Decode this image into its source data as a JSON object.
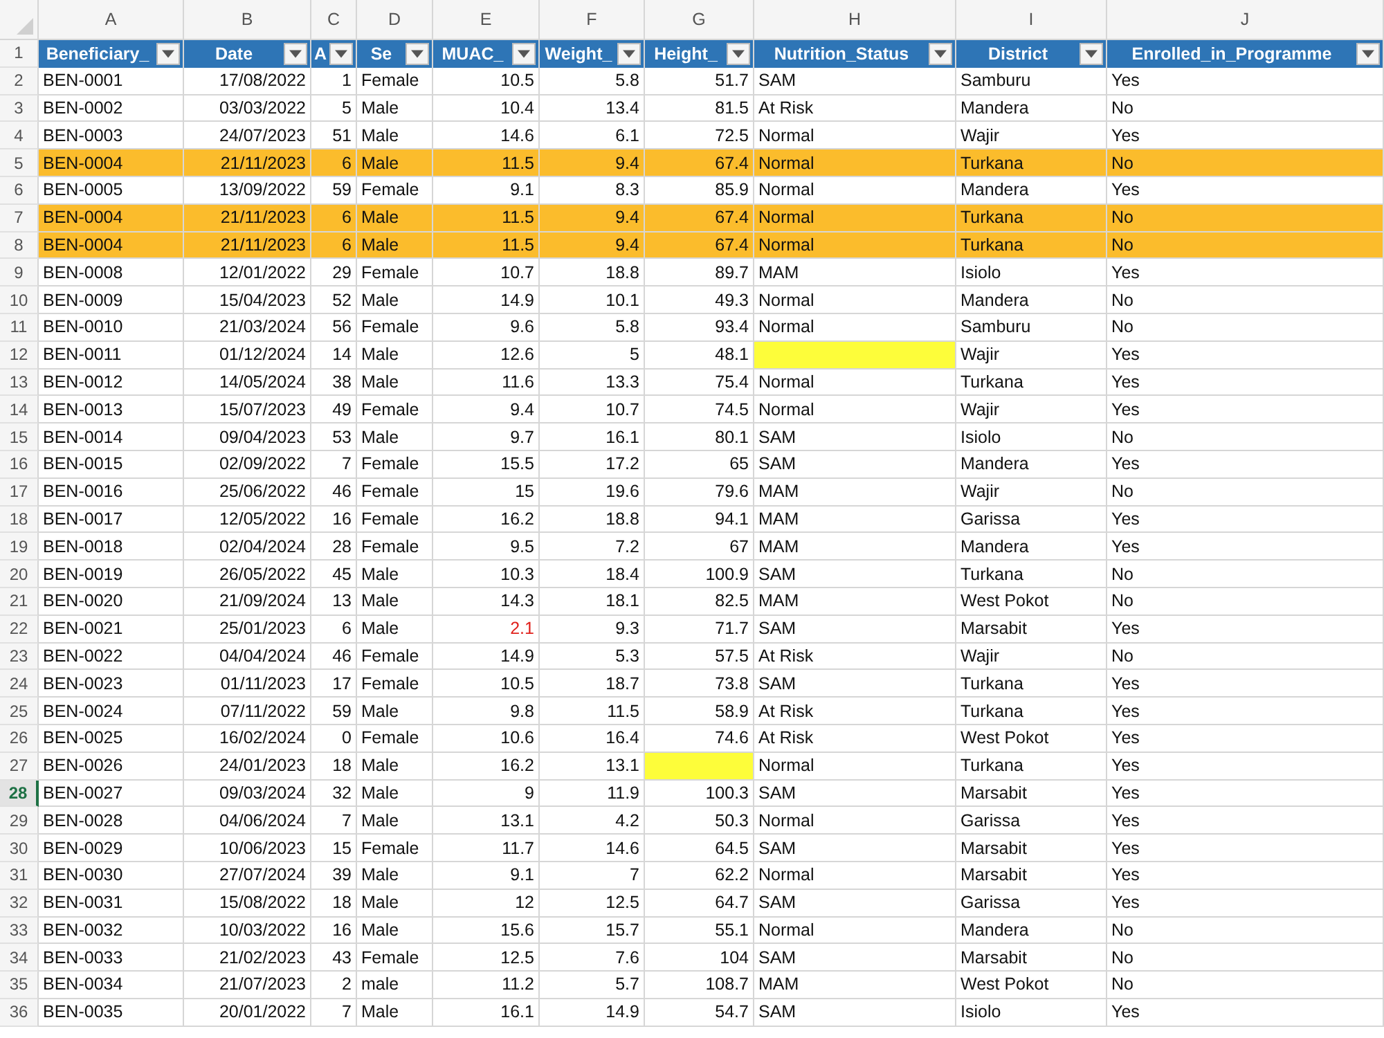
{
  "columns": [
    {
      "letter": "A",
      "header": "Beneficiary_",
      "kind": "text"
    },
    {
      "letter": "B",
      "header": "Date",
      "kind": "number"
    },
    {
      "letter": "C",
      "header": "A",
      "kind": "number"
    },
    {
      "letter": "D",
      "header": "Se",
      "kind": "text"
    },
    {
      "letter": "E",
      "header": "MUAC_",
      "kind": "number"
    },
    {
      "letter": "F",
      "header": "Weight_",
      "kind": "number"
    },
    {
      "letter": "G",
      "header": "Height_",
      "kind": "number"
    },
    {
      "letter": "H",
      "header": "Nutrition_Status",
      "kind": "text"
    },
    {
      "letter": "I",
      "header": "District",
      "kind": "text"
    },
    {
      "letter": "J",
      "header": "Enrolled_in_Programme",
      "kind": "text"
    }
  ],
  "header_row": "1",
  "rows": [
    {
      "num": "2",
      "cells": [
        "BEN-0001",
        "17/08/2022",
        "1",
        "Female",
        "10.5",
        "5.8",
        "51.7",
        "SAM",
        "Samburu",
        "Yes"
      ],
      "duplicate": false,
      "selected": false,
      "muac_flagged": false
    },
    {
      "num": "3",
      "cells": [
        "BEN-0002",
        "03/03/2022",
        "5",
        "Male",
        "10.4",
        "13.4",
        "81.5",
        "At Risk",
        "Mandera",
        "No"
      ],
      "duplicate": false,
      "selected": false,
      "muac_flagged": false
    },
    {
      "num": "4",
      "cells": [
        "BEN-0003",
        "24/07/2023",
        "51",
        "Male",
        "14.6",
        "6.1",
        "72.5",
        "Normal",
        "Wajir",
        "Yes"
      ],
      "duplicate": false,
      "selected": false,
      "muac_flagged": false
    },
    {
      "num": "5",
      "cells": [
        "BEN-0004",
        "21/11/2023",
        "6",
        "Male",
        "11.5",
        "9.4",
        "67.4",
        "Normal",
        "Turkana",
        "No"
      ],
      "duplicate": true,
      "selected": false,
      "muac_flagged": false
    },
    {
      "num": "6",
      "cells": [
        "BEN-0005",
        "13/09/2022",
        "59",
        "Female",
        "9.1",
        "8.3",
        "85.9",
        "Normal",
        "Mandera",
        "Yes"
      ],
      "duplicate": false,
      "selected": false,
      "muac_flagged": false
    },
    {
      "num": "7",
      "cells": [
        "BEN-0004",
        "21/11/2023",
        "6",
        "Male",
        "11.5",
        "9.4",
        "67.4",
        "Normal",
        "Turkana",
        "No"
      ],
      "duplicate": true,
      "selected": false,
      "muac_flagged": false
    },
    {
      "num": "8",
      "cells": [
        "BEN-0004",
        "21/11/2023",
        "6",
        "Male",
        "11.5",
        "9.4",
        "67.4",
        "Normal",
        "Turkana",
        "No"
      ],
      "duplicate": true,
      "selected": false,
      "muac_flagged": false
    },
    {
      "num": "9",
      "cells": [
        "BEN-0008",
        "12/01/2022",
        "29",
        "Female",
        "10.7",
        "18.8",
        "89.7",
        "MAM",
        "Isiolo",
        "Yes"
      ],
      "duplicate": false,
      "selected": false,
      "muac_flagged": false
    },
    {
      "num": "10",
      "cells": [
        "BEN-0009",
        "15/04/2023",
        "52",
        "Male",
        "14.9",
        "10.1",
        "49.3",
        "Normal",
        "Mandera",
        "No"
      ],
      "duplicate": false,
      "selected": false,
      "muac_flagged": false
    },
    {
      "num": "11",
      "cells": [
        "BEN-0010",
        "21/03/2024",
        "56",
        "Female",
        "9.6",
        "5.8",
        "93.4",
        "Normal",
        "Samburu",
        "No"
      ],
      "duplicate": false,
      "selected": false,
      "muac_flagged": false
    },
    {
      "num": "12",
      "cells": [
        "BEN-0011",
        "01/12/2024",
        "14",
        "Male",
        "12.6",
        "5",
        "48.1",
        null,
        "Wajir",
        "Yes"
      ],
      "duplicate": false,
      "selected": false,
      "muac_flagged": false
    },
    {
      "num": "13",
      "cells": [
        "BEN-0012",
        "14/05/2024",
        "38",
        "Male",
        "11.6",
        "13.3",
        "75.4",
        "Normal",
        "Turkana",
        "Yes"
      ],
      "duplicate": false,
      "selected": false,
      "muac_flagged": false
    },
    {
      "num": "14",
      "cells": [
        "BEN-0013",
        "15/07/2023",
        "49",
        "Female",
        "9.4",
        "10.7",
        "74.5",
        "Normal",
        "Wajir",
        "Yes"
      ],
      "duplicate": false,
      "selected": false,
      "muac_flagged": false
    },
    {
      "num": "15",
      "cells": [
        "BEN-0014",
        "09/04/2023",
        "53",
        "Male",
        "9.7",
        "16.1",
        "80.1",
        "SAM",
        "Isiolo",
        "No"
      ],
      "duplicate": false,
      "selected": false,
      "muac_flagged": false
    },
    {
      "num": "16",
      "cells": [
        "BEN-0015",
        "02/09/2022",
        "7",
        "Female",
        "15.5",
        "17.2",
        "65",
        "SAM",
        "Mandera",
        "Yes"
      ],
      "duplicate": false,
      "selected": false,
      "muac_flagged": false
    },
    {
      "num": "17",
      "cells": [
        "BEN-0016",
        "25/06/2022",
        "46",
        "Female",
        "15",
        "19.6",
        "79.6",
        "MAM",
        "Wajir",
        "No"
      ],
      "duplicate": false,
      "selected": false,
      "muac_flagged": false
    },
    {
      "num": "18",
      "cells": [
        "BEN-0017",
        "12/05/2022",
        "16",
        "Female",
        "16.2",
        "18.8",
        "94.1",
        "MAM",
        "Garissa",
        "Yes"
      ],
      "duplicate": false,
      "selected": false,
      "muac_flagged": false
    },
    {
      "num": "19",
      "cells": [
        "BEN-0018",
        "02/04/2024",
        "28",
        "Female",
        "9.5",
        "7.2",
        "67",
        "MAM",
        "Mandera",
        "Yes"
      ],
      "duplicate": false,
      "selected": false,
      "muac_flagged": false
    },
    {
      "num": "20",
      "cells": [
        "BEN-0019",
        "26/05/2022",
        "45",
        "Male",
        "10.3",
        "18.4",
        "100.9",
        "SAM",
        "Turkana",
        "No"
      ],
      "duplicate": false,
      "selected": false,
      "muac_flagged": false
    },
    {
      "num": "21",
      "cells": [
        "BEN-0020",
        "21/09/2024",
        "13",
        "Male",
        "14.3",
        "18.1",
        "82.5",
        "MAM",
        "West Pokot",
        "No"
      ],
      "duplicate": false,
      "selected": false,
      "muac_flagged": false
    },
    {
      "num": "22",
      "cells": [
        "BEN-0021",
        "25/01/2023",
        "6",
        "Male",
        "2.1",
        "9.3",
        "71.7",
        "SAM",
        "Marsabit",
        "Yes"
      ],
      "duplicate": false,
      "selected": false,
      "muac_flagged": true
    },
    {
      "num": "23",
      "cells": [
        "BEN-0022",
        "04/04/2024",
        "46",
        "Female",
        "14.9",
        "5.3",
        "57.5",
        "At Risk",
        "Wajir",
        "No"
      ],
      "duplicate": false,
      "selected": false,
      "muac_flagged": false
    },
    {
      "num": "24",
      "cells": [
        "BEN-0023",
        "01/11/2023",
        "17",
        "Female",
        "10.5",
        "18.7",
        "73.8",
        "SAM",
        "Turkana",
        "Yes"
      ],
      "duplicate": false,
      "selected": false,
      "muac_flagged": false
    },
    {
      "num": "25",
      "cells": [
        "BEN-0024",
        "07/11/2022",
        "59",
        "Male",
        "9.8",
        "11.5",
        "58.9",
        "At Risk",
        "Turkana",
        "Yes"
      ],
      "duplicate": false,
      "selected": false,
      "muac_flagged": false
    },
    {
      "num": "26",
      "cells": [
        "BEN-0025",
        "16/02/2024",
        "0",
        "Female",
        "10.6",
        "16.4",
        "74.6",
        "At Risk",
        "West Pokot",
        "Yes"
      ],
      "duplicate": false,
      "selected": false,
      "muac_flagged": false
    },
    {
      "num": "27",
      "cells": [
        "BEN-0026",
        "24/01/2023",
        "18",
        "Male",
        "16.2",
        "13.1",
        null,
        "Normal",
        "Turkana",
        "Yes"
      ],
      "duplicate": false,
      "selected": false,
      "muac_flagged": false
    },
    {
      "num": "28",
      "cells": [
        "BEN-0027",
        "09/03/2024",
        "32",
        "Male",
        "9",
        "11.9",
        "100.3",
        "SAM",
        "Marsabit",
        "Yes"
      ],
      "duplicate": false,
      "selected": true,
      "muac_flagged": false
    },
    {
      "num": "29",
      "cells": [
        "BEN-0028",
        "04/06/2024",
        "7",
        "Male",
        "13.1",
        "4.2",
        "50.3",
        "Normal",
        "Garissa",
        "Yes"
      ],
      "duplicate": false,
      "selected": false,
      "muac_flagged": false
    },
    {
      "num": "30",
      "cells": [
        "BEN-0029",
        "10/06/2023",
        "15",
        "Female",
        "11.7",
        "14.6",
        "64.5",
        "SAM",
        "Marsabit",
        "Yes"
      ],
      "duplicate": false,
      "selected": false,
      "muac_flagged": false
    },
    {
      "num": "31",
      "cells": [
        "BEN-0030",
        "27/07/2024",
        "39",
        "Male",
        "9.1",
        "7",
        "62.2",
        "Normal",
        "Marsabit",
        "Yes"
      ],
      "duplicate": false,
      "selected": false,
      "muac_flagged": false
    },
    {
      "num": "32",
      "cells": [
        "BEN-0031",
        "15/08/2022",
        "18",
        "Male",
        "12",
        "12.5",
        "64.7",
        "SAM",
        "Garissa",
        "Yes"
      ],
      "duplicate": false,
      "selected": false,
      "muac_flagged": false
    },
    {
      "num": "33",
      "cells": [
        "BEN-0032",
        "10/03/2022",
        "16",
        "Male",
        "15.6",
        "15.7",
        "55.1",
        "Normal",
        "Mandera",
        "No"
      ],
      "duplicate": false,
      "selected": false,
      "muac_flagged": false
    },
    {
      "num": "34",
      "cells": [
        "BEN-0033",
        "21/02/2023",
        "43",
        "Female",
        "12.5",
        "7.6",
        "104",
        "SAM",
        "Marsabit",
        "No"
      ],
      "duplicate": false,
      "selected": false,
      "muac_flagged": false
    },
    {
      "num": "35",
      "cells": [
        "BEN-0034",
        "21/07/2023",
        "2",
        "male",
        "11.2",
        "5.7",
        "108.7",
        "MAM",
        "West Pokot",
        "No"
      ],
      "duplicate": false,
      "selected": false,
      "muac_flagged": false
    },
    {
      "num": "36",
      "cells": [
        "BEN-0035",
        "20/01/2022",
        "7",
        "Male",
        "16.1",
        "14.9",
        "54.7",
        "SAM",
        "Isiolo",
        "Yes"
      ],
      "duplicate": false,
      "selected": false,
      "muac_flagged": false
    }
  ]
}
